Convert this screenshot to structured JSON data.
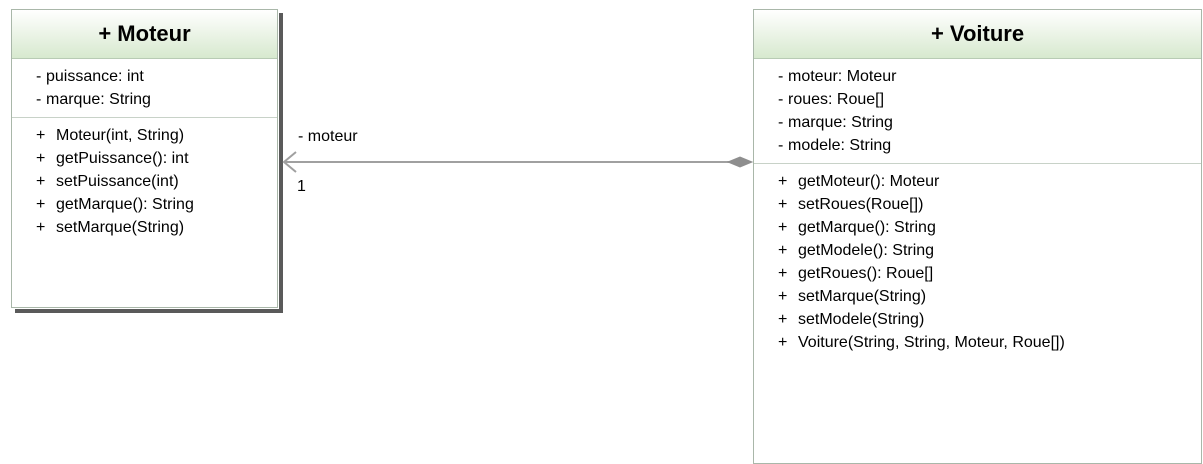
{
  "classes": {
    "moteur": {
      "name": "+ Moteur",
      "attributes": [
        {
          "visibility": "-",
          "text": "puissance: int"
        },
        {
          "visibility": "-",
          "text": "marque: String"
        }
      ],
      "methods": [
        {
          "visibility": "+",
          "text": "Moteur(int, String)"
        },
        {
          "visibility": "+",
          "text": "getPuissance(): int"
        },
        {
          "visibility": "+",
          "text": "setPuissance(int)"
        },
        {
          "visibility": "+",
          "text": "getMarque(): String"
        },
        {
          "visibility": "+",
          "text": "setMarque(String)"
        }
      ]
    },
    "voiture": {
      "name": "+ Voiture",
      "attributes": [
        {
          "visibility": "-",
          "text": "moteur: Moteur"
        },
        {
          "visibility": "-",
          "text": "roues: Roue[]"
        },
        {
          "visibility": "-",
          "text": "marque: String"
        },
        {
          "visibility": "-",
          "text": "modele: String"
        }
      ],
      "methods": [
        {
          "visibility": "+",
          "text": "getMoteur(): Moteur"
        },
        {
          "visibility": "+",
          "text": "setRoues(Roue[])"
        },
        {
          "visibility": "+",
          "text": "getMarque(): String"
        },
        {
          "visibility": "+",
          "text": "getModele(): String"
        },
        {
          "visibility": "+",
          "text": "getRoues(): Roue[]"
        },
        {
          "visibility": "+",
          "text": "setMarque(String)"
        },
        {
          "visibility": "+",
          "text": "setModele(String)"
        },
        {
          "visibility": "+",
          "text": "Voiture(String, String, Moteur, Roue[])"
        }
      ]
    }
  },
  "association": {
    "role": "- moteur",
    "multiplicity": "1",
    "kind": "composition",
    "navigable_toward": "moteur"
  },
  "colors": {
    "header_gradient_end": "#d7e9cf",
    "border": "#a9b7a9",
    "connector": "#a0a0a0"
  }
}
